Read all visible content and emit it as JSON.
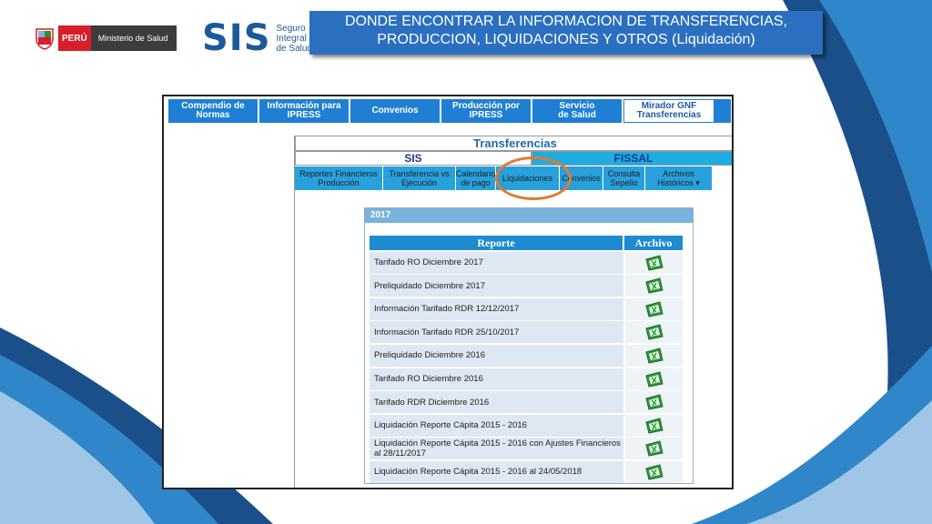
{
  "header": {
    "minsa_peru": "PERÚ",
    "minsa_ministry": "Ministerio de Salud",
    "sis_logo": "SIS",
    "sis_logo_sub": [
      "Seguro",
      "Integral",
      "de Salud"
    ],
    "title_line1": "DONDE ENCONTRAR LA INFORMACION DE TRANSFERENCIAS,",
    "title_line2": "PRODUCCION, LIQUIDACIONES Y OTROS (Liquidación)"
  },
  "topnav": [
    {
      "line1": "Compendio de",
      "line2": "Normas"
    },
    {
      "line1": "Información para",
      "line2": "IPRESS"
    },
    {
      "line1": "Convenios",
      "line2": ""
    },
    {
      "line1": "Producción por",
      "line2": "IPRESS"
    },
    {
      "line1": "Servicio",
      "line2": "de Salud"
    },
    {
      "line1": "Mirador GNF",
      "line2": "Transferencias"
    }
  ],
  "panel": {
    "heading": "Transferencias",
    "tab_sis": "SIS",
    "tab_fissal": "FISSAL",
    "subnav": [
      {
        "line1": "Reportes Financieros",
        "line2": "Producción"
      },
      {
        "line1": "Transferencia vs",
        "line2": "Ejecución"
      },
      {
        "line1": "Calendario",
        "line2": "de pago"
      },
      {
        "line1": "Liquidaciones",
        "line2": ""
      },
      {
        "line1": "Convenios",
        "line2": ""
      },
      {
        "line1": "Consulta",
        "line2": "Sepelio"
      },
      {
        "line1": "Archivos",
        "line2": "Históricos ▾"
      }
    ]
  },
  "report": {
    "year": "2017",
    "col_report": "Reporte",
    "col_file": "Archivo",
    "rows": [
      "Tarifado RO Diciembre 2017",
      "Preliquidado Diciembre 2017",
      "Información Tarifado RDR 12/12/2017",
      "Información Tarifado RDR 25/10/2017",
      "Preliquidado Diciembre 2016",
      "Tarifado RO Diciembre 2016",
      "Tarifado RDR Diciembre 2016",
      "Liquidación Reporte Cápita 2015 - 2016",
      "Liquidación Reporte Cápita 2015 - 2016 con Ajustes Financieros al 28/11/2017",
      "Liquidación Reporte Cápita 2015 - 2016 al 24/05/2018"
    ]
  },
  "colors": {
    "title_bg": "#2a6fc0",
    "nav_blue": "#1e7fd4",
    "fissal_cyan": "#1dade0",
    "highlight_ring": "#e07a32",
    "excel_green": "#2e9a3a"
  },
  "icons": [
    "peru-shield-icon",
    "excel-file-icon"
  ]
}
